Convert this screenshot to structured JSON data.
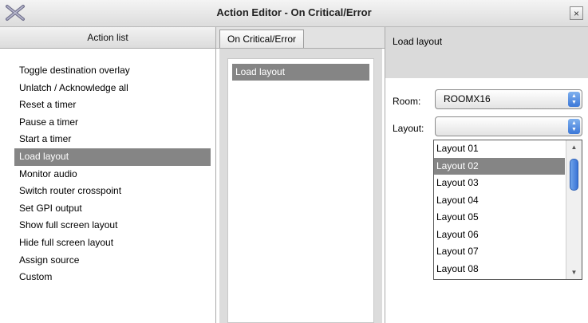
{
  "window": {
    "title": "Action Editor - On Critical/Error",
    "close_glyph": "×",
    "icon": "app-x-icon"
  },
  "action_list": {
    "header": "Action list",
    "items": [
      "Toggle destination overlay",
      "Unlatch / Acknowledge all",
      "Reset a timer",
      "Pause a timer",
      "Start a timer",
      "Load layout",
      "Monitor audio",
      "Switch router crosspoint",
      "Set GPI output",
      "Show full screen layout",
      "Hide full screen layout",
      "Assign source",
      "Custom"
    ],
    "selected": "Load layout"
  },
  "sequence": {
    "tab_label": "On Critical/Error",
    "items": [
      "Load layout"
    ]
  },
  "properties": {
    "header": "Load layout",
    "room": {
      "label": "Room:",
      "value": "ROOMX16"
    },
    "layout": {
      "label": "Layout:",
      "value": "",
      "options": [
        "Layout 01",
        "Layout 02",
        "Layout 03",
        "Layout 04",
        "Layout 05",
        "Layout 06",
        "Layout 07",
        "Layout 08"
      ],
      "highlighted": "Layout 02"
    }
  },
  "colors": {
    "selection": "#858585",
    "scroll_accent": "#3c78d8"
  }
}
